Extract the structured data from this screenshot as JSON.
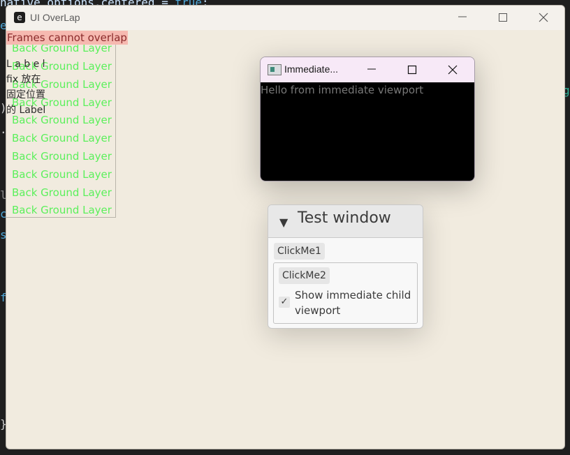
{
  "background_code": {
    "line0_prefix": "native_options.centered = ",
    "line0_keyword": "true",
    "line0_suffix": ";",
    "fragments": [
      "e",
      ")",
      ".",
      "l",
      "c",
      "s",
      "f",
      "}",
      "g"
    ]
  },
  "window": {
    "title": "UI OverLap",
    "app_icon": "e",
    "controls": [
      "minimize",
      "maximize",
      "close"
    ]
  },
  "warning_label": "Frames cannot overlap",
  "background_layer": {
    "items": [
      "Back Ground Layer",
      "Back Ground Layer",
      "Back Ground Layer",
      "Back Ground Layer",
      "Back Ground Layer",
      "Back Ground Layer",
      "Back Ground Layer",
      "Back Ground Layer",
      "Back Ground Layer",
      "Back Ground Layer"
    ],
    "color": "#5bf05b"
  },
  "fixed_label": {
    "lines": [
      "L a b e l",
      "fix 放在",
      "固定位置",
      "的 Label"
    ]
  },
  "immediate_viewport": {
    "title": "Immediate...",
    "body_text": "Hello from immediate viewport"
  },
  "test_window": {
    "title": "Test window",
    "button1": "ClickMe1",
    "button2": "ClickMe2",
    "checkbox_label": "Show immediate child viewport",
    "checkbox_checked": true,
    "check_mark": "✓",
    "collapse_icon": "▼"
  }
}
